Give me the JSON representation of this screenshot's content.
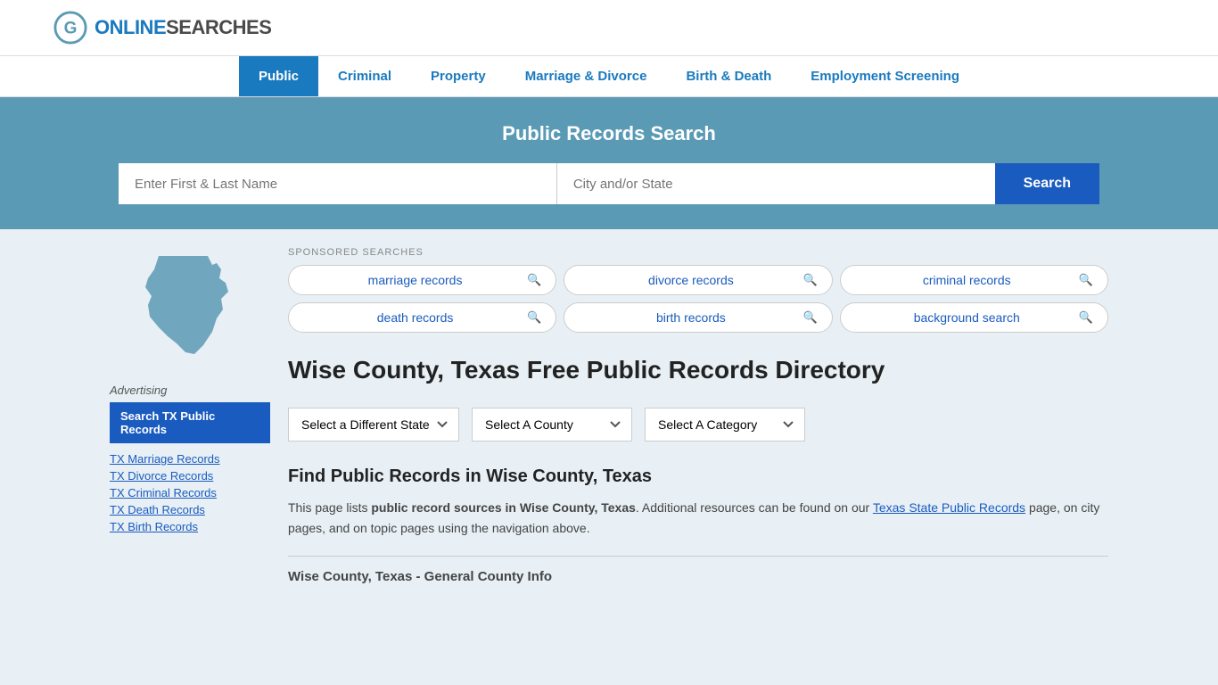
{
  "site": {
    "logo_text_1": "ONLINE",
    "logo_text_2": "SEARCHES"
  },
  "nav": {
    "items": [
      {
        "label": "Public",
        "active": true
      },
      {
        "label": "Criminal",
        "active": false
      },
      {
        "label": "Property",
        "active": false
      },
      {
        "label": "Marriage & Divorce",
        "active": false
      },
      {
        "label": "Birth & Death",
        "active": false
      },
      {
        "label": "Employment Screening",
        "active": false
      }
    ]
  },
  "search_section": {
    "title": "Public Records Search",
    "name_placeholder": "Enter First & Last Name",
    "location_placeholder": "City and/or State",
    "button_label": "Search"
  },
  "sponsored": {
    "label": "SPONSORED SEARCHES",
    "items": [
      {
        "text": "marriage records"
      },
      {
        "text": "divorce records"
      },
      {
        "text": "criminal records"
      },
      {
        "text": "death records"
      },
      {
        "text": "birth records"
      },
      {
        "text": "background search"
      }
    ]
  },
  "page": {
    "heading": "Wise County, Texas Free Public Records Directory",
    "dropdowns": {
      "state_label": "Select a Different State",
      "county_label": "Select A County",
      "category_label": "Select A Category"
    },
    "find_title": "Find Public Records in Wise County, Texas",
    "find_body_1": "This page lists ",
    "find_body_bold": "public record sources in Wise County, Texas",
    "find_body_2": ". Additional resources can be found on our ",
    "find_link_text": "Texas State Public Records",
    "find_body_3": " page, on city pages, and on topic pages using the navigation above.",
    "general_info_heading": "Wise County, Texas - General County Info"
  },
  "sidebar": {
    "advertising_label": "Advertising",
    "ad_button_label": "Search TX Public Records",
    "links": [
      {
        "label": "TX Marriage Records"
      },
      {
        "label": "TX Divorce Records"
      },
      {
        "label": "TX Criminal Records"
      },
      {
        "label": "TX Death Records"
      },
      {
        "label": "TX Birth Records"
      }
    ]
  }
}
